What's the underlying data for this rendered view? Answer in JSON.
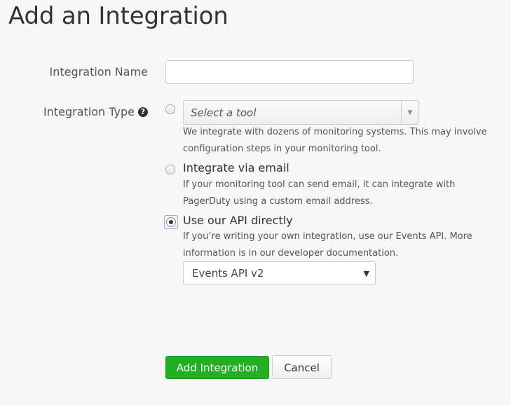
{
  "page": {
    "title": "Add an Integration"
  },
  "form": {
    "name_label": "Integration Name",
    "name_value": "",
    "type_label": "Integration Type",
    "type_options": {
      "tool": {
        "select_placeholder": "Select a tool",
        "description_line1": "We integrate with dozens of monitoring systems. This may involve",
        "description_line2": "configuration steps in your monitoring tool.",
        "selected": false
      },
      "email": {
        "label": "Integrate via email",
        "description_line1": "If your monitoring tool can send email, it can integrate with",
        "description_line2": "PagerDuty using a custom email address.",
        "selected": false
      },
      "api": {
        "label": "Use our API directly",
        "description_line1": "If you’re writing your own integration, use our Events API. More",
        "description_line2": "information is in our developer documentation.",
        "selected": true,
        "version_selected": "Events API v2"
      }
    }
  },
  "actions": {
    "submit_label": "Add Integration",
    "cancel_label": "Cancel"
  },
  "colors": {
    "primary_button": "#22b022",
    "background": "#f7f7f7"
  },
  "icons": {
    "help": "question-circle-icon",
    "dropdown": "caret-down-icon"
  }
}
